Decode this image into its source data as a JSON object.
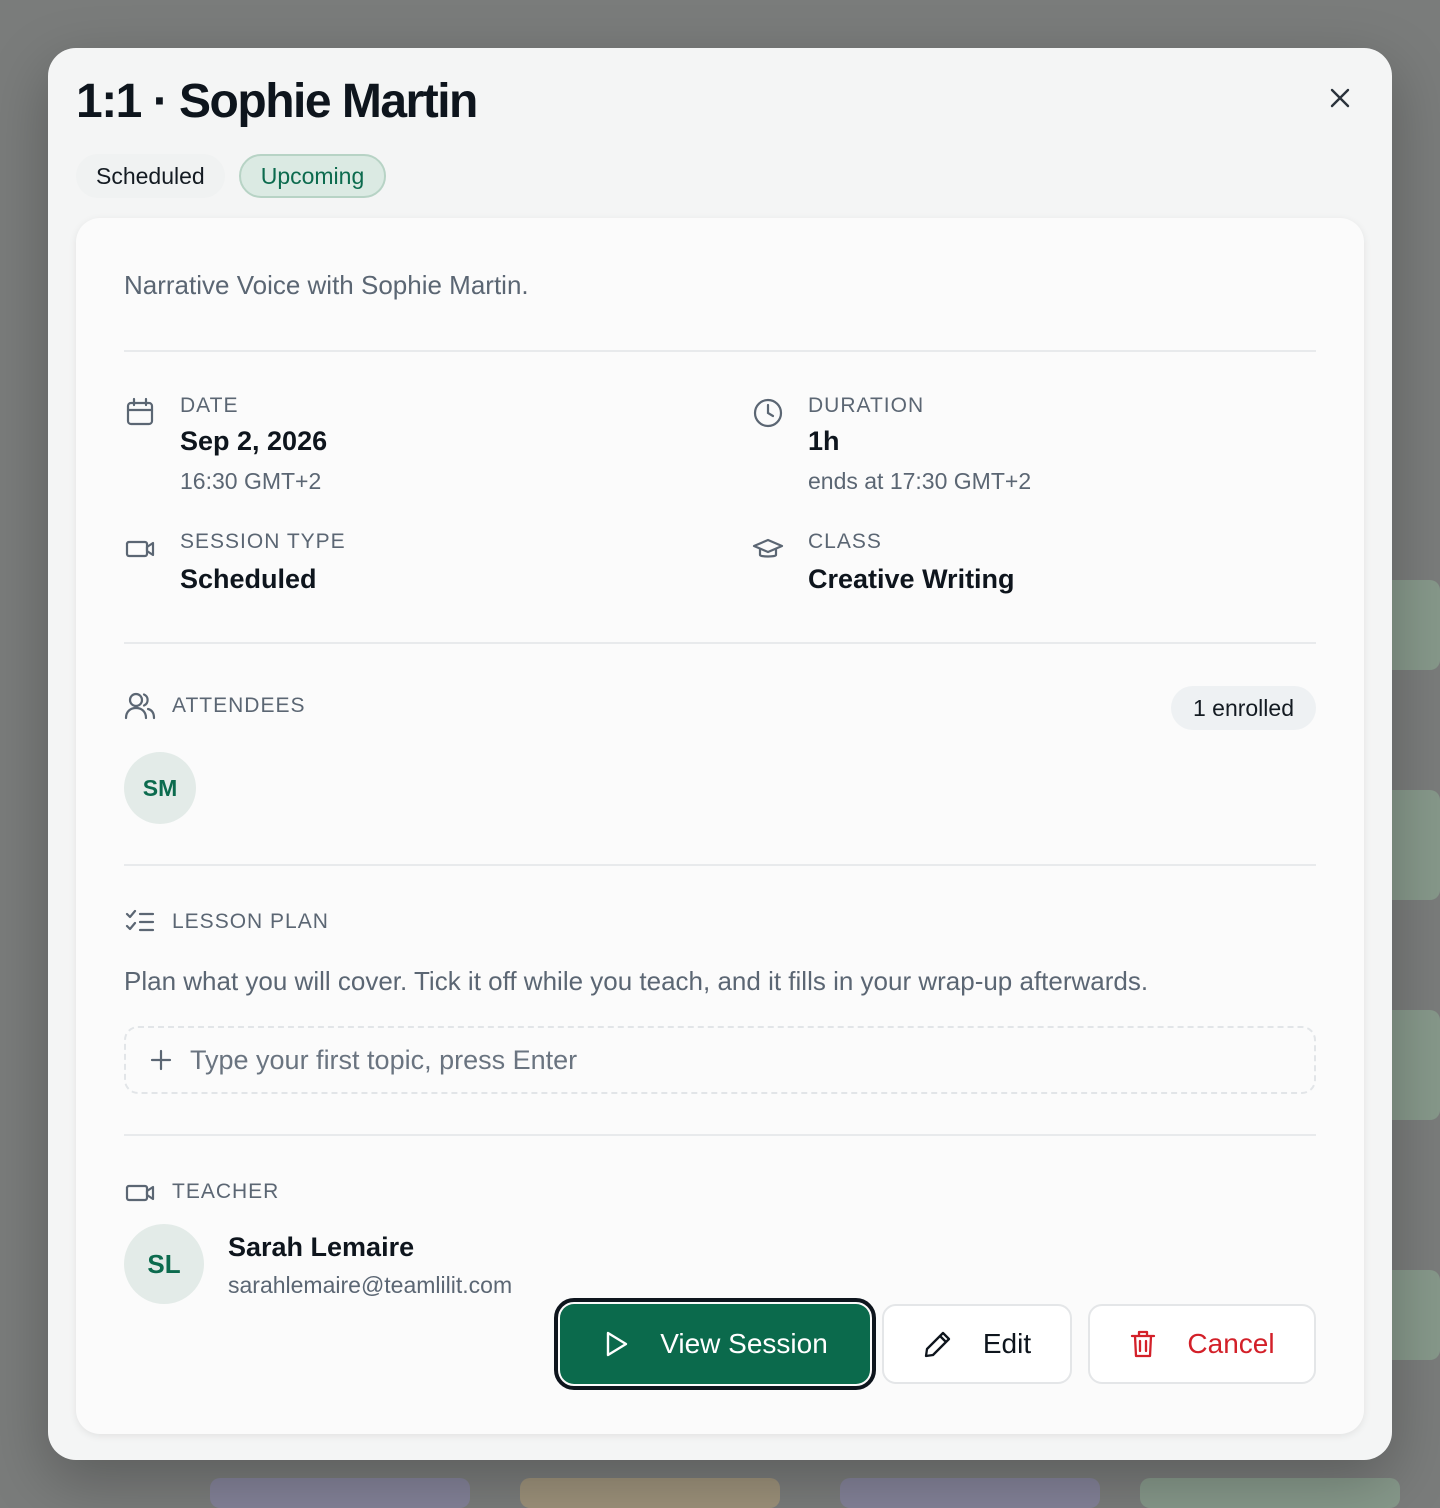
{
  "dialog": {
    "title": "1:1 · Sophie Martin",
    "badges": [
      "Scheduled",
      "Upcoming"
    ],
    "description": "Narrative Voice with Sophie Martin.",
    "date": {
      "label": "DATE",
      "value": "Sep 2, 2026",
      "sub": "16:30 GMT+2"
    },
    "duration": {
      "label": "DURATION",
      "value": "1h",
      "sub": "ends at 17:30 GMT+2"
    },
    "session_type": {
      "label": "SESSION TYPE",
      "value": "Scheduled"
    },
    "class": {
      "label": "CLASS",
      "value": "Creative Writing"
    },
    "attendees": {
      "label": "ATTENDEES",
      "count": "1 enrolled",
      "items": [
        {
          "initials": "SM"
        }
      ]
    },
    "lesson_plan": {
      "label": "LESSON PLAN",
      "hint": "Plan what you will cover. Tick it off while you teach, and it fills in your wrap-up afterwards.",
      "placeholder": "Type your first topic, press Enter"
    },
    "teacher": {
      "label": "TEACHER",
      "initials": "SL",
      "name": "Sarah Lemaire",
      "email": "sarahlemaire@teamlilit.com"
    },
    "actions": {
      "view": "View Session",
      "edit": "Edit",
      "cancel": "Cancel"
    }
  },
  "colors": {
    "accent": "#0b6a4c",
    "danger": "#d32029",
    "badge_green_bg": "#dbeae3",
    "muted_text": "#5b6673"
  },
  "icons": {
    "close": "close-icon",
    "date": "calendar-icon",
    "duration": "clock-icon",
    "session_type": "video-camera-icon",
    "class": "graduation-cap-icon",
    "attendees": "users-icon",
    "lesson_plan": "checklist-icon",
    "add": "plus-icon",
    "teacher": "video-camera-icon",
    "view": "play-icon",
    "edit": "pencil-icon",
    "cancel": "trash-icon"
  }
}
